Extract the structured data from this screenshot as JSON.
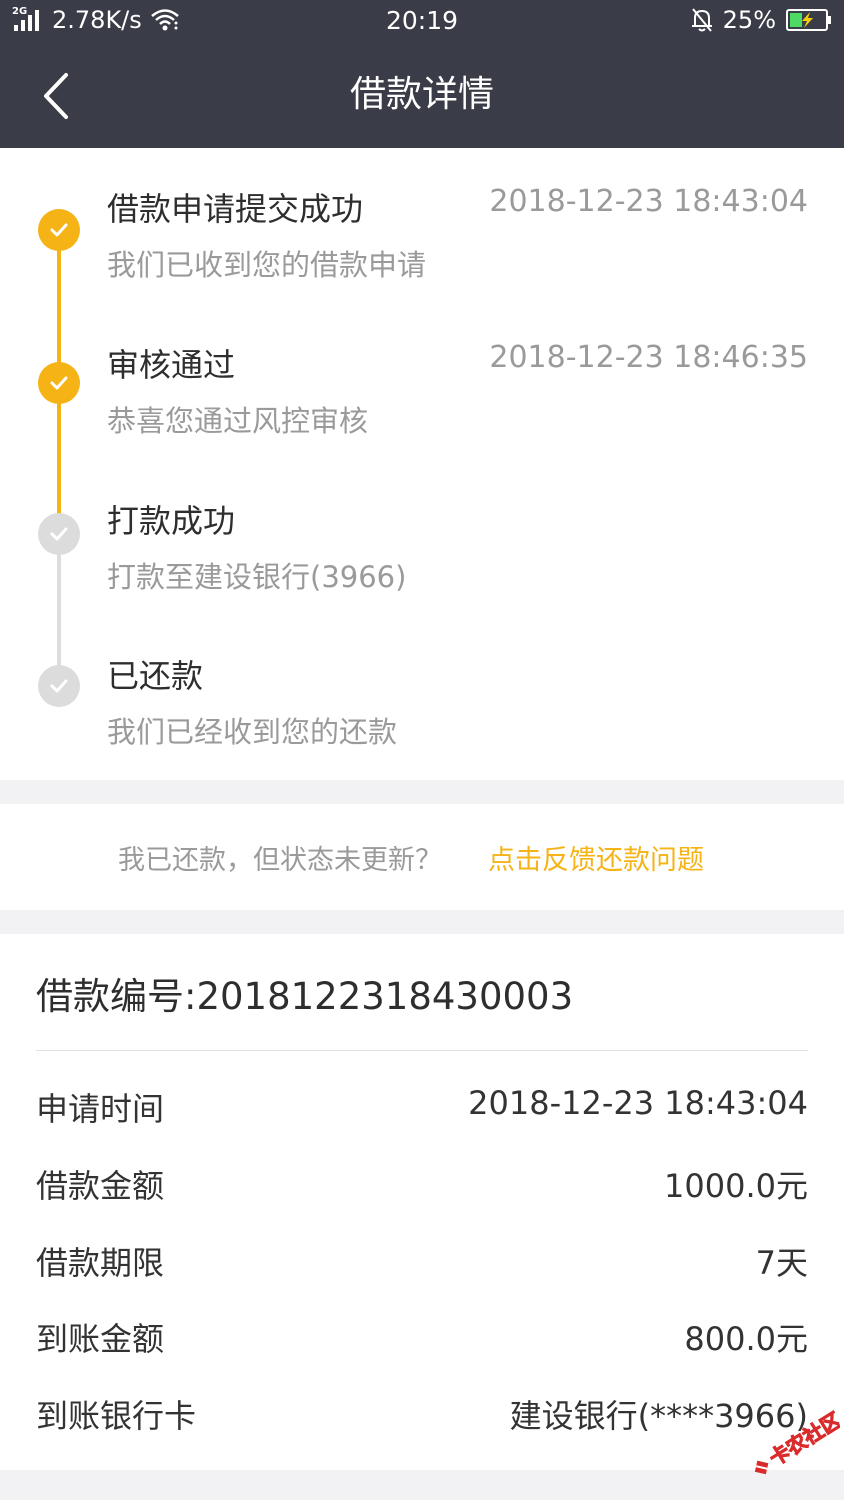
{
  "statusbar": {
    "network_type": "2G",
    "speed": "2.78K/s",
    "time": "20:19",
    "battery": "25%"
  },
  "nav": {
    "title": "借款详情",
    "back_icon": "chevron-left-icon"
  },
  "timeline": {
    "steps": [
      {
        "title": "借款申请提交成功",
        "desc": "我们已收到您的借款申请",
        "time": "2018-12-23 18:43:04",
        "done": true
      },
      {
        "title": "审核通过",
        "desc": "恭喜您通过风控审核",
        "time": "2018-12-23 18:46:35",
        "done": true
      },
      {
        "title": "打款成功",
        "desc": "打款至建设银行(3966)",
        "time": "",
        "done": false
      },
      {
        "title": "已还款",
        "desc": "我们已经收到您的还款",
        "time": "",
        "done": false
      }
    ]
  },
  "feedback": {
    "text": "我已还款，但状态未更新？",
    "link": "点击反馈还款问题"
  },
  "detail": {
    "loan_number": "借款编号:2018122318430003",
    "rows": [
      {
        "label": "申请时间",
        "value": "2018-12-23 18:43:04"
      },
      {
        "label": "借款金额",
        "value": "1000.0元"
      },
      {
        "label": "借款期限",
        "value": "7天"
      },
      {
        "label": "到账金额",
        "value": "800.0元"
      },
      {
        "label": "到账银行卡",
        "value": "建设银行(****3966)"
      }
    ]
  },
  "watermark": {
    "text": "卡农社区"
  },
  "colors": {
    "header_bg": "#3a3c47",
    "accent": "#f5b316",
    "done_dot": "#f5b316",
    "pending_dot": "#dcdcdc",
    "page_bg": "#f2f2f4"
  }
}
